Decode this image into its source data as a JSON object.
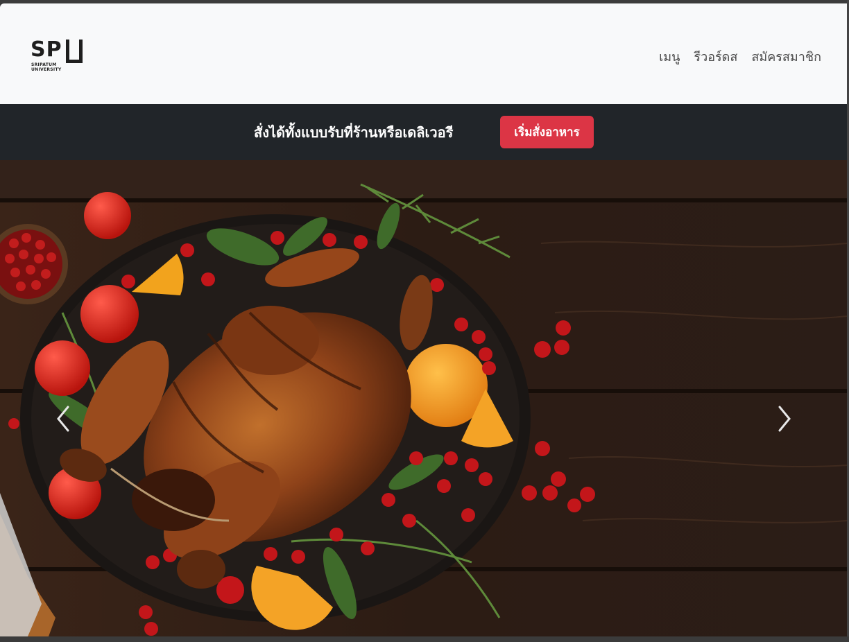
{
  "brand": {
    "logo_text": "SPU",
    "logo_sub_1": "SRIPATUM",
    "logo_sub_2": "UNIVERSITY"
  },
  "nav": {
    "items": [
      {
        "label": "เมนู"
      },
      {
        "label": "รีวอร์ดส"
      },
      {
        "label": "สมัครสมาชิก"
      }
    ]
  },
  "promo": {
    "text": "สั่งได้ทั้งแบบรับที่ร้านหรือเดลิเวอรี",
    "button_label": "เริ่มสั่งอาหาร",
    "button_color": "#dc3545",
    "bar_color": "#212529"
  },
  "carousel": {
    "slide_subject": "roast-chicken-platter-image",
    "prev_icon": "chevron-left-icon",
    "next_icon": "chevron-right-icon"
  }
}
